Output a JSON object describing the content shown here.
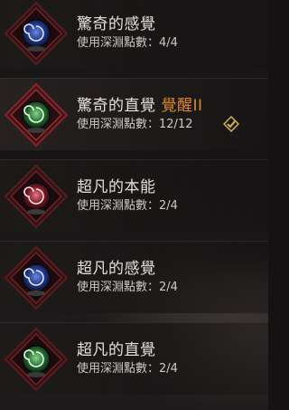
{
  "skills": [
    {
      "name": "驚奇的感覺",
      "points_label": "使用深淵點數：",
      "points": "4/4",
      "awaken": "",
      "gem_icon": "blue-spiral-orb-icon",
      "gem_color": "#2a3f8f"
    },
    {
      "name": "驚奇的直覺",
      "points_label": "使用深淵點數：",
      "points": "12/12",
      "awaken": "覺醒II",
      "gem_icon": "green-spiral-orb-icon",
      "gem_color": "#2f7a3a"
    },
    {
      "name": "超凡的本能",
      "points_label": "使用深淵點數：",
      "points": "2/4",
      "awaken": "",
      "gem_icon": "red-spiral-orb-icon",
      "gem_color": "#8a1f2e"
    },
    {
      "name": "超凡的感覺",
      "points_label": "使用深淵點數：",
      "points": "2/4",
      "awaken": "",
      "gem_icon": "blue-spiral-orb-icon",
      "gem_color": "#2a3f8f"
    },
    {
      "name": "超凡的直覺",
      "points_label": "使用深淵點數：",
      "points": "2/4",
      "awaken": "",
      "gem_icon": "green-spiral-orb-icon",
      "gem_color": "#2f7a3a"
    }
  ],
  "colors": {
    "awaken_text": "#e0892b",
    "check_gold": "#d9b64a",
    "frame_red": "#7a1e22"
  }
}
